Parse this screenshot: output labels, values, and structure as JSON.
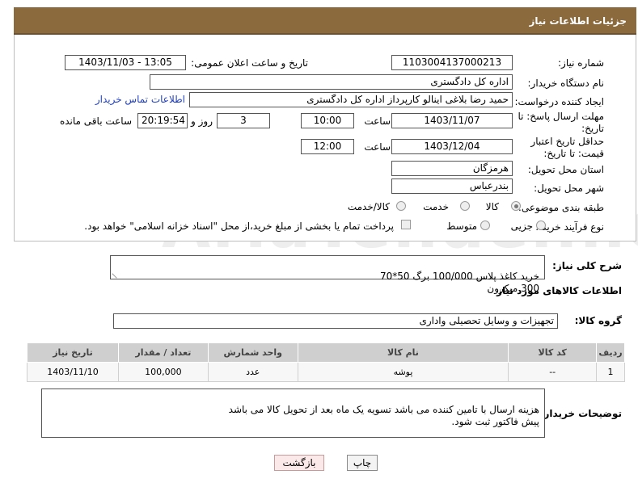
{
  "header": {
    "title": "جزئیات اطلاعات نیاز"
  },
  "form": {
    "need_number_label": "شماره نیاز:",
    "need_number": "1103004137000213",
    "announce_label": "تاریخ و ساعت اعلان عمومی:",
    "announce_value": "1403/11/03 - 13:05",
    "buyer_org_label": "نام دستگاه خریدار:",
    "buyer_org": "اداره کل دادگستری",
    "creator_label": "ایجاد کننده درخواست:",
    "creator": "حمید رضا  بلاغی اینالو کارپرداز اداره کل دادگستری",
    "buyer_contact_link": "اطلاعات تماس خریدار",
    "deadline_label": "مهلت ارسال پاسخ: تا تاریخ:",
    "deadline_date": "1403/11/07",
    "time_label": "ساعت",
    "deadline_time": "10:00",
    "days_value": "3",
    "days_label": "روز و",
    "remaining_time": "20:19:54",
    "remaining_label": "ساعت باقی مانده",
    "validity_label": "حداقل تاریخ اعتبار قیمت: تا تاریخ:",
    "validity_date": "1403/12/04",
    "validity_time": "12:00",
    "province_label": "استان محل تحویل:",
    "province": "هرمزگان",
    "city_label": "شهر محل تحویل:",
    "city": "بندرعباس",
    "category_label": "طبقه بندی موضوعی:",
    "category_options": [
      "کالا",
      "خدمت",
      "کالا/خدمت"
    ],
    "purchase_type_label": "نوع فرآیند خرید :",
    "purchase_options": [
      "جزیی",
      "متوسط"
    ],
    "payment_note": "پرداخت تمام یا بخشی از مبلغ خرید،از محل \"اسناد خزانه اسلامی\" خواهد بود."
  },
  "description": {
    "label": "شرح کلی نیاز:",
    "text": "خرید کاغذ پلاس 100/000 برگ 50*70\n300 میکرون"
  },
  "goods": {
    "section_title": "اطلاعات کالاهای مورد نیاز",
    "group_label": "گروه کالا:",
    "group_value": "تجهیزات و وسایل تحصیلی واداری",
    "columns": [
      "ردیف",
      "کد کالا",
      "نام کالا",
      "واحد شمارش",
      "تعداد / مقدار",
      "تاریخ نیاز"
    ],
    "rows": [
      [
        "1",
        "--",
        "پوشه",
        "عدد",
        "100,000",
        "1403/11/10"
      ]
    ]
  },
  "buyer_notes": {
    "label": "توضیحات خریدار:",
    "text": "هزینه ارسال با تامین کننده می باشد تسویه یک ماه بعد از تحویل کالا می باشد\nپیش فاکتور ثبت شود."
  },
  "buttons": {
    "print": "چاپ",
    "back": "بازگشت"
  },
  "watermark": "AriaTender.neT"
}
